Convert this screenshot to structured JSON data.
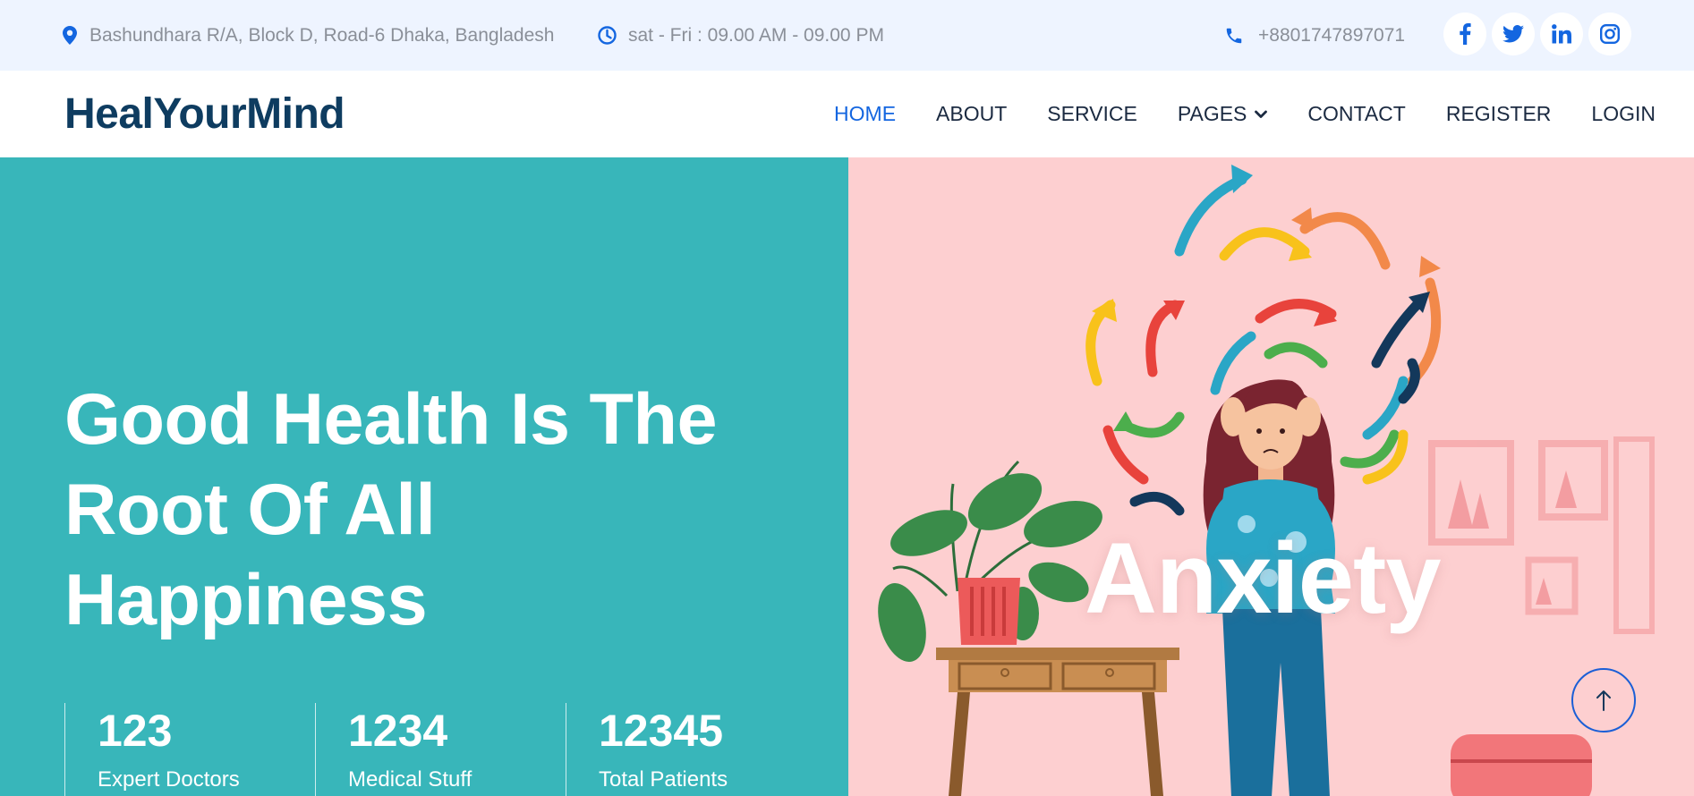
{
  "topbar": {
    "address": "Bashundhara R/A, Block D, Road-6 Dhaka, Bangladesh",
    "hours": "sat - Fri : 09.00 AM - 09.00 PM",
    "phone": "+8801747897071",
    "address_icon": "map-pin-icon",
    "hours_icon": "clock-icon",
    "phone_icon": "phone-icon",
    "socials": [
      "facebook-icon",
      "twitter-icon",
      "linkedin-icon",
      "instagram-icon"
    ]
  },
  "nav": {
    "brand": "HealYourMind",
    "items": [
      {
        "label": "HOME",
        "active": true
      },
      {
        "label": "ABOUT"
      },
      {
        "label": "SERVICE"
      },
      {
        "label": "PAGES",
        "has_dropdown": true
      },
      {
        "label": "CONTACT"
      },
      {
        "label": "REGISTER"
      },
      {
        "label": "LOGIN"
      }
    ]
  },
  "hero": {
    "title_lines": [
      "Good Health Is The",
      "Root Of All",
      "Happiness"
    ],
    "stats": [
      {
        "value": "123",
        "label": "Expert Doctors"
      },
      {
        "value": "1234",
        "label": "Medical Stuff"
      },
      {
        "value": "12345",
        "label": "Total Patients"
      }
    ],
    "image_caption": "Anxiety"
  },
  "scroll_top_icon": "arrow-up-icon",
  "colors": {
    "accent": "#1466e0",
    "brand": "#0e3c60",
    "hero_teal": "#38b6ba",
    "hero_pink": "#fdcfd0",
    "topbar_bg": "#eef4ff"
  }
}
